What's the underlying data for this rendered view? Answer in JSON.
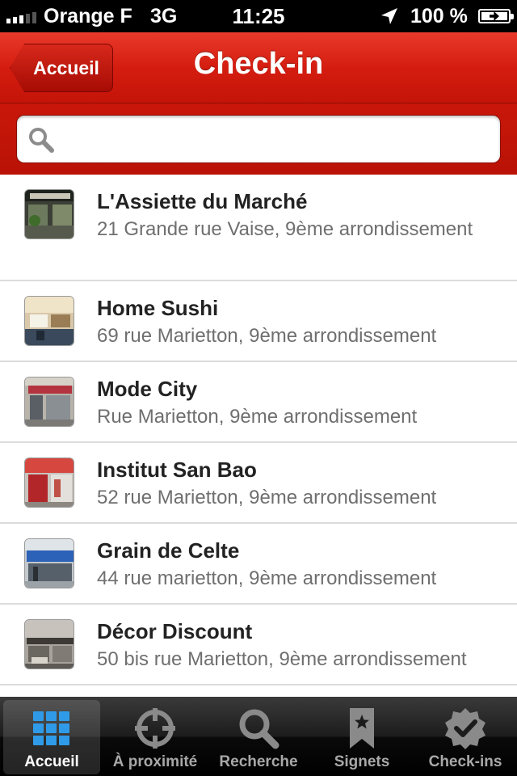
{
  "status_bar": {
    "carrier": "Orange F",
    "network": "3G",
    "time": "11:25",
    "battery": "100 %"
  },
  "nav": {
    "back_label": "Accueil",
    "title": "Check-in"
  },
  "search": {
    "placeholder": "",
    "value": ""
  },
  "places": [
    {
      "name": "L'Assiette du Marché",
      "address": "21 Grande rue Vaise, 9ème arrondissement"
    },
    {
      "name": "Home Sushi",
      "address": "69 rue Marietton, 9ème arrondissement"
    },
    {
      "name": "Mode City",
      "address": "Rue Marietton, 9ème arrondissement"
    },
    {
      "name": "Institut San Bao",
      "address": "52 rue Marietton, 9ème arrondissement"
    },
    {
      "name": "Grain de Celte",
      "address": "44 rue marietton, 9ème arrondissement"
    },
    {
      "name": "Décor Discount",
      "address": "50 bis rue Marietton, 9ème arrondissement"
    }
  ],
  "tabs": [
    {
      "label": "Accueil",
      "icon": "grid-icon",
      "active": true
    },
    {
      "label": "À proximité",
      "icon": "crosshair-icon",
      "active": false
    },
    {
      "label": "Recherche",
      "icon": "magnifier-icon",
      "active": false
    },
    {
      "label": "Signets",
      "icon": "bookmark-icon",
      "active": false
    },
    {
      "label": "Check-ins",
      "icon": "checkmark-badge-icon",
      "active": false
    }
  ],
  "colors": {
    "brand_red": "#d41d10",
    "active_tab_blue": "#2f9be8"
  }
}
